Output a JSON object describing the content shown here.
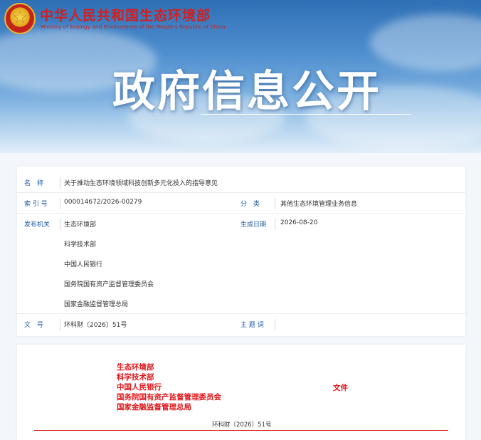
{
  "header": {
    "ministry_cn": "中华人民共和国生态环境部",
    "ministry_en": "Ministry of Ecology and Environment of the People's Republic of China",
    "banner_title": "政府信息公开"
  },
  "info": {
    "name_label": "名　称",
    "name_value": "关于推动生态环境领域科技创新多元化投入的指导意见",
    "index_label": "索 引 号",
    "index_value": "000014672/2026-00279",
    "category_label": "分　类",
    "category_value": "其他生态环境管理业务信息",
    "publisher_label": "发布机关",
    "publishers": [
      "生态环境部",
      "科学技术部",
      "中国人民银行",
      "国务院国有资产监督管理委员会",
      "国家金融监督管理总局"
    ],
    "date_label": "生成日期",
    "date_value": "2026-08-20",
    "docno_label": "文　号",
    "docno_value": "环科财〔2026〕51号",
    "keywords_label": "主 题 词",
    "keywords_value": ""
  },
  "document": {
    "issuers": [
      "生态环境部",
      "科学技术部",
      "中国人民银行",
      "国务院国有资产监督管理委员会",
      "国家金融监督管理总局"
    ],
    "wenjian": "文件",
    "doc_number": "环科财〔2026〕51号"
  },
  "colors": {
    "label_blue": "#1e5aa8",
    "doc_red": "#e0161b",
    "ministry_red": "#d21f1f"
  }
}
